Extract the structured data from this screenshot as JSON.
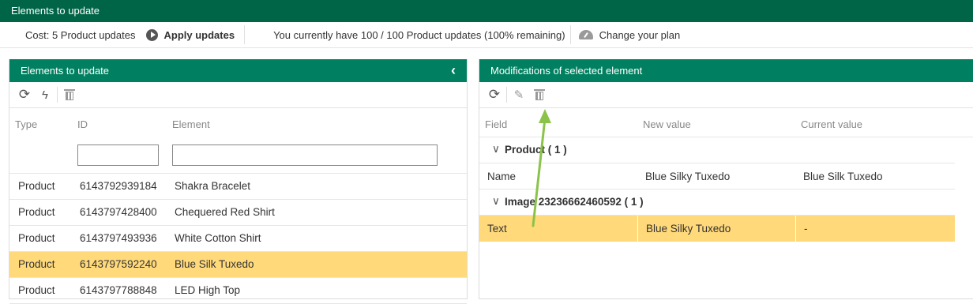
{
  "window": {
    "title": "Elements to update"
  },
  "toolbar": {
    "cost": "Cost: 5 Product updates",
    "apply_label": "Apply updates",
    "quota": "You currently have 100 / 100 Product updates (100% remaining)",
    "change_plan": "Change your plan"
  },
  "left_panel": {
    "title": "Elements to update",
    "columns": {
      "type": "Type",
      "id": "ID",
      "element": "Element"
    },
    "filters": {
      "id": "",
      "element": ""
    },
    "rows": [
      {
        "type": "Product",
        "id": "6143792939184",
        "element": "Shakra Bracelet",
        "selected": false
      },
      {
        "type": "Product",
        "id": "6143797428400",
        "element": "Chequered Red Shirt",
        "selected": false
      },
      {
        "type": "Product",
        "id": "6143797493936",
        "element": "White Cotton Shirt",
        "selected": false
      },
      {
        "type": "Product",
        "id": "6143797592240",
        "element": "Blue Silk Tuxedo",
        "selected": true
      },
      {
        "type": "Product",
        "id": "6143797788848",
        "element": "LED High Top",
        "selected": false
      }
    ]
  },
  "right_panel": {
    "title": "Modifications of selected element",
    "columns": {
      "field": "Field",
      "new_value": "New value",
      "current_value": "Current value"
    },
    "groups": [
      {
        "label": "Product ( 1 )",
        "rows": [
          {
            "field": "Name",
            "new_value": "Blue Silky Tuxedo",
            "current_value": "Blue Silk Tuxedo",
            "selected": false
          }
        ]
      },
      {
        "label": "Image 23236662460592 ( 1 )",
        "rows": [
          {
            "field": "Text",
            "new_value": "Blue Silky Tuxedo",
            "current_value": "-",
            "selected": true
          }
        ]
      }
    ]
  },
  "colors": {
    "header_dark": "#006446",
    "header": "#008060",
    "selected_row": "#ffd97a",
    "annotation_arrow": "#8bc34a"
  },
  "icons": [
    "play-icon",
    "gauge-icon",
    "refresh-icon",
    "bolt-icon",
    "trash-icon",
    "pencil-icon",
    "chevron-left-icon",
    "chevron-down-icon"
  ]
}
